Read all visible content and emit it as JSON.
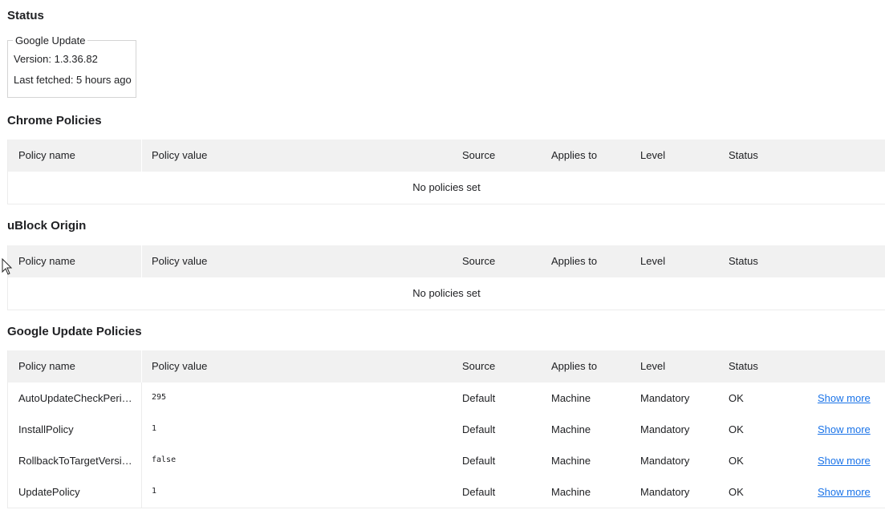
{
  "status": {
    "title": "Status",
    "box_legend": "Google Update",
    "version": "Version: 1.3.36.82",
    "last_fetched": "Last fetched: 5 hours ago"
  },
  "columns": {
    "name": "Policy name",
    "value": "Policy value",
    "source": "Source",
    "applies_to": "Applies to",
    "level": "Level",
    "status": "Status"
  },
  "chrome_policies": {
    "title": "Chrome Policies",
    "empty_text": "No policies set"
  },
  "ublock": {
    "title": "uBlock Origin",
    "empty_text": "No policies set"
  },
  "google_update_policies": {
    "title": "Google Update Policies",
    "rows": [
      {
        "name": "AutoUpdateCheckPeri…",
        "value": "295",
        "source": "Default",
        "applies_to": "Machine",
        "level": "Mandatory",
        "status": "OK",
        "more": "Show more"
      },
      {
        "name": "InstallPolicy",
        "value": "1",
        "source": "Default",
        "applies_to": "Machine",
        "level": "Mandatory",
        "status": "OK",
        "more": "Show more"
      },
      {
        "name": "RollbackToTargetVersi…",
        "value": "false",
        "source": "Default",
        "applies_to": "Machine",
        "level": "Mandatory",
        "status": "OK",
        "more": "Show more"
      },
      {
        "name": "UpdatePolicy",
        "value": "1",
        "source": "Default",
        "applies_to": "Machine",
        "level": "Mandatory",
        "status": "OK",
        "more": "Show more"
      }
    ]
  },
  "icons": {
    "cursor": "mouse-pointer-icon"
  }
}
